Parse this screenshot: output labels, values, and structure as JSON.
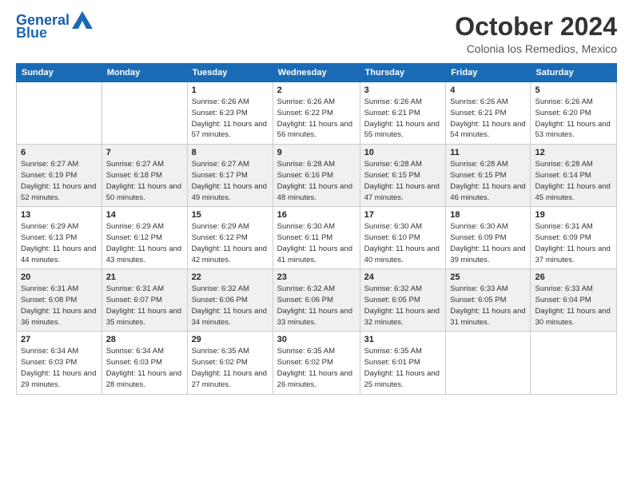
{
  "logo": {
    "line1": "General",
    "line2": "Blue"
  },
  "title": "October 2024",
  "location": "Colonia los Remedios, Mexico",
  "days_of_week": [
    "Sunday",
    "Monday",
    "Tuesday",
    "Wednesday",
    "Thursday",
    "Friday",
    "Saturday"
  ],
  "weeks": [
    [
      {
        "day": "",
        "info": ""
      },
      {
        "day": "",
        "info": ""
      },
      {
        "day": "1",
        "info": "Sunrise: 6:26 AM\nSunset: 6:23 PM\nDaylight: 11 hours and 57 minutes."
      },
      {
        "day": "2",
        "info": "Sunrise: 6:26 AM\nSunset: 6:22 PM\nDaylight: 11 hours and 56 minutes."
      },
      {
        "day": "3",
        "info": "Sunrise: 6:26 AM\nSunset: 6:21 PM\nDaylight: 11 hours and 55 minutes."
      },
      {
        "day": "4",
        "info": "Sunrise: 6:26 AM\nSunset: 6:21 PM\nDaylight: 11 hours and 54 minutes."
      },
      {
        "day": "5",
        "info": "Sunrise: 6:26 AM\nSunset: 6:20 PM\nDaylight: 11 hours and 53 minutes."
      }
    ],
    [
      {
        "day": "6",
        "info": "Sunrise: 6:27 AM\nSunset: 6:19 PM\nDaylight: 11 hours and 52 minutes."
      },
      {
        "day": "7",
        "info": "Sunrise: 6:27 AM\nSunset: 6:18 PM\nDaylight: 11 hours and 50 minutes."
      },
      {
        "day": "8",
        "info": "Sunrise: 6:27 AM\nSunset: 6:17 PM\nDaylight: 11 hours and 49 minutes."
      },
      {
        "day": "9",
        "info": "Sunrise: 6:28 AM\nSunset: 6:16 PM\nDaylight: 11 hours and 48 minutes."
      },
      {
        "day": "10",
        "info": "Sunrise: 6:28 AM\nSunset: 6:15 PM\nDaylight: 11 hours and 47 minutes."
      },
      {
        "day": "11",
        "info": "Sunrise: 6:28 AM\nSunset: 6:15 PM\nDaylight: 11 hours and 46 minutes."
      },
      {
        "day": "12",
        "info": "Sunrise: 6:28 AM\nSunset: 6:14 PM\nDaylight: 11 hours and 45 minutes."
      }
    ],
    [
      {
        "day": "13",
        "info": "Sunrise: 6:29 AM\nSunset: 6:13 PM\nDaylight: 11 hours and 44 minutes."
      },
      {
        "day": "14",
        "info": "Sunrise: 6:29 AM\nSunset: 6:12 PM\nDaylight: 11 hours and 43 minutes."
      },
      {
        "day": "15",
        "info": "Sunrise: 6:29 AM\nSunset: 6:12 PM\nDaylight: 11 hours and 42 minutes."
      },
      {
        "day": "16",
        "info": "Sunrise: 6:30 AM\nSunset: 6:11 PM\nDaylight: 11 hours and 41 minutes."
      },
      {
        "day": "17",
        "info": "Sunrise: 6:30 AM\nSunset: 6:10 PM\nDaylight: 11 hours and 40 minutes."
      },
      {
        "day": "18",
        "info": "Sunrise: 6:30 AM\nSunset: 6:09 PM\nDaylight: 11 hours and 39 minutes."
      },
      {
        "day": "19",
        "info": "Sunrise: 6:31 AM\nSunset: 6:09 PM\nDaylight: 11 hours and 37 minutes."
      }
    ],
    [
      {
        "day": "20",
        "info": "Sunrise: 6:31 AM\nSunset: 6:08 PM\nDaylight: 11 hours and 36 minutes."
      },
      {
        "day": "21",
        "info": "Sunrise: 6:31 AM\nSunset: 6:07 PM\nDaylight: 11 hours and 35 minutes."
      },
      {
        "day": "22",
        "info": "Sunrise: 6:32 AM\nSunset: 6:06 PM\nDaylight: 11 hours and 34 minutes."
      },
      {
        "day": "23",
        "info": "Sunrise: 6:32 AM\nSunset: 6:06 PM\nDaylight: 11 hours and 33 minutes."
      },
      {
        "day": "24",
        "info": "Sunrise: 6:32 AM\nSunset: 6:05 PM\nDaylight: 11 hours and 32 minutes."
      },
      {
        "day": "25",
        "info": "Sunrise: 6:33 AM\nSunset: 6:05 PM\nDaylight: 11 hours and 31 minutes."
      },
      {
        "day": "26",
        "info": "Sunrise: 6:33 AM\nSunset: 6:04 PM\nDaylight: 11 hours and 30 minutes."
      }
    ],
    [
      {
        "day": "27",
        "info": "Sunrise: 6:34 AM\nSunset: 6:03 PM\nDaylight: 11 hours and 29 minutes."
      },
      {
        "day": "28",
        "info": "Sunrise: 6:34 AM\nSunset: 6:03 PM\nDaylight: 11 hours and 28 minutes."
      },
      {
        "day": "29",
        "info": "Sunrise: 6:35 AM\nSunset: 6:02 PM\nDaylight: 11 hours and 27 minutes."
      },
      {
        "day": "30",
        "info": "Sunrise: 6:35 AM\nSunset: 6:02 PM\nDaylight: 11 hours and 26 minutes."
      },
      {
        "day": "31",
        "info": "Sunrise: 6:35 AM\nSunset: 6:01 PM\nDaylight: 11 hours and 25 minutes."
      },
      {
        "day": "",
        "info": ""
      },
      {
        "day": "",
        "info": ""
      }
    ]
  ]
}
